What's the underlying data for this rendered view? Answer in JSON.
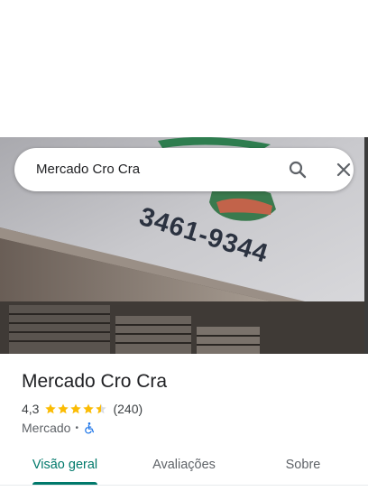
{
  "search": {
    "query": "Mercado Cro Cra"
  },
  "photo": {
    "sign_phone": "3461-9344"
  },
  "place": {
    "name": "Mercado Cro Cra",
    "rating": "4,3",
    "rating_value": 4.3,
    "rating_max": 5,
    "review_count": "(240)",
    "category": "Mercado",
    "separator": "•",
    "accessibility_icon": "wheelchair-icon"
  },
  "tabs": [
    {
      "label": "Visão geral",
      "active": true
    },
    {
      "label": "Avaliações",
      "active": false
    },
    {
      "label": "Sobre",
      "active": false
    }
  ],
  "colors": {
    "accent": "#00796b",
    "star": "#fbbc04",
    "wheelchair": "#1a73e8"
  }
}
